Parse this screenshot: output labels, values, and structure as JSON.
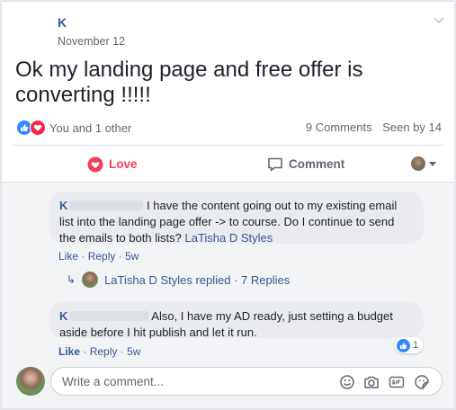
{
  "post": {
    "author": "K",
    "date": "November 12",
    "text": "Ok my landing page and free offer is converting !!!!!"
  },
  "reactions": {
    "text": "You and 1 other",
    "comments_count": "9 Comments",
    "seen_by": "Seen by 14"
  },
  "actions": {
    "love_label": "Love",
    "comment_label": "Comment"
  },
  "comments": [
    {
      "author": "K",
      "text": "I have the content going out to my existing email list into the landing page offer -> to course. Do I continue to send the emails to both lists?",
      "mention": "LaTisha D Styles",
      "like_label": "Like",
      "reply_label": "Reply",
      "time": "5w"
    },
    {
      "author": "K",
      "text": "Also, I have my AD ready, just setting a budget aside before I hit publish and let it run.",
      "like_label": "Like",
      "reply_label": "Reply",
      "time": "5w",
      "like_count": "1"
    }
  ],
  "replies_summary": "LaTisha D Styles replied · 7 Replies",
  "composer": {
    "placeholder": "Write a comment..."
  },
  "colors": {
    "link": "#385898",
    "love": "#f33e58",
    "like": "#2d88ff"
  }
}
